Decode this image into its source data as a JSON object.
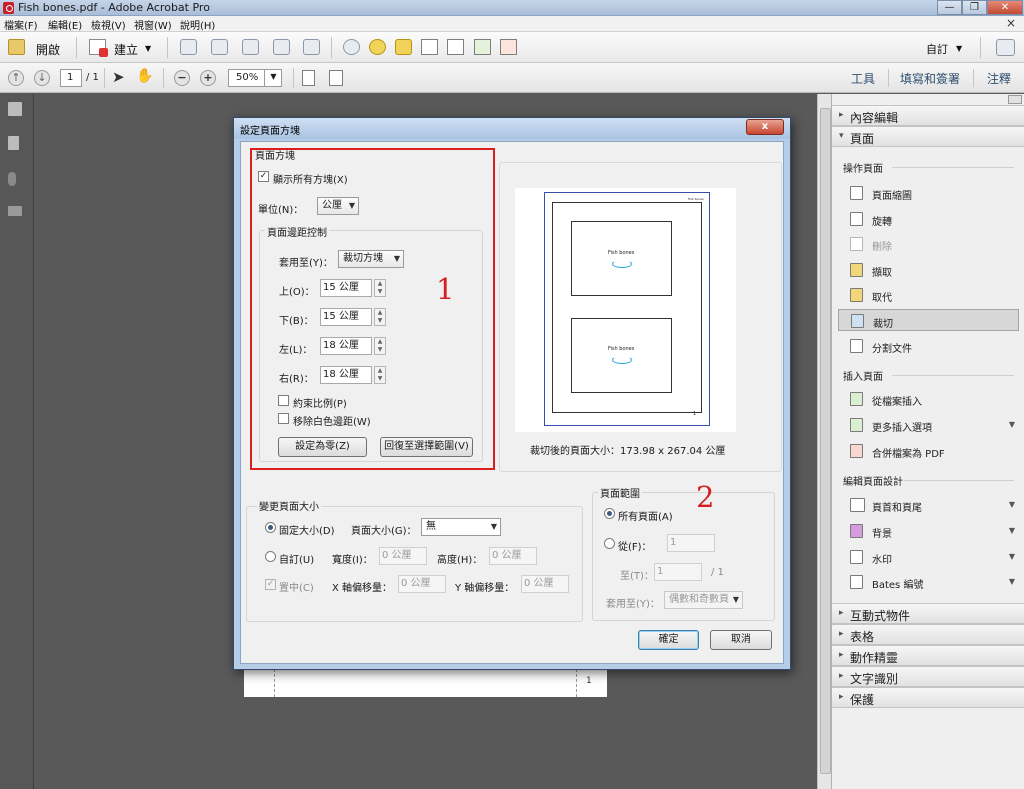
{
  "window": {
    "title": "Fish  bones.pdf - Adobe Acrobat Pro",
    "buttons": {
      "minimize": "—",
      "maximize": "❐",
      "close": "✕"
    }
  },
  "menubar": {
    "items": [
      "檔案(F)",
      "編輯(E)",
      "檢視(V)",
      "視窗(W)",
      "說明(H)"
    ],
    "close": "×"
  },
  "toolbar": {
    "open_label": "開啟",
    "create_label": "建立",
    "customize_label": "自訂"
  },
  "nav": {
    "page_current": "1",
    "page_total": "/ 1",
    "zoom": "50%",
    "tabs": [
      "工具",
      "填寫和簽署",
      "注釋"
    ]
  },
  "document": {
    "page_number": "1"
  },
  "right_pane": {
    "sections_top": [
      "內容編輯",
      "頁面"
    ],
    "groups": [
      {
        "title": "操作頁面",
        "items": [
          {
            "label": "頁面縮圖",
            "icon": "page-thumbnails-icon"
          },
          {
            "label": "旋轉",
            "icon": "rotate-icon"
          },
          {
            "label": "刪除",
            "icon": "delete-page-icon"
          },
          {
            "label": "擷取",
            "icon": "extract-icon"
          },
          {
            "label": "取代",
            "icon": "replace-icon"
          },
          {
            "label": "裁切",
            "icon": "crop-icon"
          },
          {
            "label": "分割文件",
            "icon": "split-document-icon"
          }
        ]
      },
      {
        "title": "插入頁面",
        "items": [
          {
            "label": "從檔案插入",
            "icon": "insert-from-file-icon"
          },
          {
            "label": "更多插入選項",
            "icon": "more-insert-icon"
          },
          {
            "label": "合併檔案為 PDF",
            "icon": "combine-files-icon"
          }
        ]
      },
      {
        "title": "編輯頁面設計",
        "items": [
          {
            "label": "頁首和頁尾",
            "icon": "header-footer-icon"
          },
          {
            "label": "背景",
            "icon": "background-icon"
          },
          {
            "label": "水印",
            "icon": "watermark-icon"
          },
          {
            "label": "Bates 編號",
            "icon": "bates-numbering-icon"
          }
        ]
      }
    ],
    "sections_bottom": [
      "互動式物件",
      "表格",
      "動作精靈",
      "文字識別",
      "保護"
    ]
  },
  "dialog": {
    "title": "設定頁面方塊",
    "close": "x",
    "page_boxes": {
      "legend": "頁面方塊",
      "show_all_boxes": "顯示所有方塊(X)",
      "units_label": "單位(N)：",
      "units_value": "公厘"
    },
    "margin_controls": {
      "legend": "頁面邊距控制",
      "apply_to_label": "套用至(Y)：",
      "apply_to_value": "裁切方塊",
      "top_label": "上(O)：",
      "top_value": "15 公厘",
      "bottom_label": "下(B)：",
      "bottom_value": "15 公厘",
      "left_label": "左(L)：",
      "left_value": "18 公厘",
      "right_label": "右(R)：",
      "right_value": "18 公厘",
      "constrain": "約束比例(P)",
      "remove_white": "移除白色邊距(W)",
      "set_zero": "設定為零(Z)",
      "revert": "回復至選擇範圍(V)"
    },
    "preview": {
      "header_text": "Fish bones",
      "page_label": "Fish  bones",
      "size_text": "裁切後的頁面大小：173.98 x 267.04 公厘"
    },
    "change_size": {
      "legend": "變更頁面大小",
      "fixed": "固定大小(D)",
      "page_size_label": "頁面大小(G)：",
      "page_size_value": "無",
      "custom": "自訂(U)",
      "width_label": "寬度(I)：",
      "width_value": "0 公厘",
      "height_label": "高度(H)：",
      "height_value": "0 公厘",
      "center": "置中(C)",
      "x_offset_label": "X 軸偏移量：",
      "x_offset_value": "0 公厘",
      "y_offset_label": "Y 軸偏移量：",
      "y_offset_value": "0 公厘"
    },
    "page_range": {
      "legend": "頁面範圍",
      "all_pages": "所有頁面(A)",
      "from_label": "從(F)：",
      "from_value": "1",
      "to_label": "至(T)：",
      "to_value": "1",
      "to_total": "/ 1",
      "apply_label": "套用至(Y)：",
      "apply_value": "偶數和奇數頁"
    },
    "ok": "確定",
    "cancel": "取消"
  },
  "annotations": {
    "label_1": "1",
    "label_2": "2",
    "highlight_color": "#d81e1e"
  }
}
